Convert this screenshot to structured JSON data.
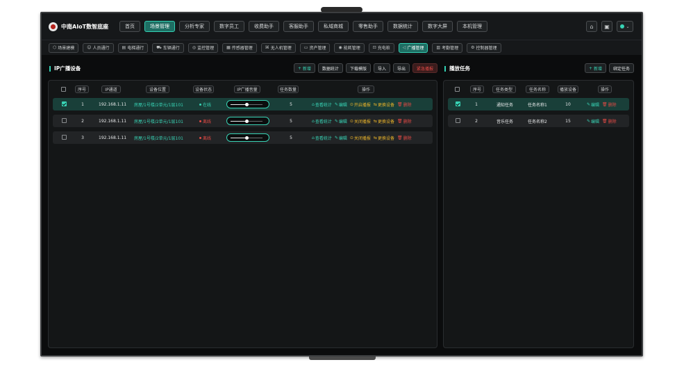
{
  "app": {
    "title": "中南AIoT数智底座"
  },
  "nav": {
    "tabs": [
      "首页",
      "场景管理",
      "分析专家",
      "数字员工",
      "收费助手",
      "客服助手",
      "私域商城",
      "零售助手",
      "数据统计",
      "数字大屏",
      "本机管理"
    ],
    "active": 1
  },
  "subnav": {
    "tabs": [
      "场景建模",
      "人员通行",
      "电梯通行",
      "车辆通行",
      "监控管理",
      "传感器管理",
      "无人机管理",
      "资产管理",
      "能耗管理",
      "充电桩",
      "广播管理",
      "考勤管理",
      "控制器管理"
    ],
    "active": 10
  },
  "left": {
    "title": "IP广播设备",
    "tools": {
      "add": "新增",
      "stats": "数据统计",
      "template": "下载模版",
      "import": "导入",
      "export": "导出",
      "emergency": "紧急播报"
    },
    "headers": [
      "序号",
      "IP通道",
      "设备位置",
      "设备状态",
      "IP广播音量",
      "任务数量",
      "操作"
    ],
    "rows": [
      {
        "no": "1",
        "ip": "192.168.1.11",
        "loc": "房屋/1号楼/2单元/1层101",
        "status": "在线",
        "online": true,
        "volume": 0.5,
        "tasks": "5",
        "checked": true,
        "toggle": "开启播报"
      },
      {
        "no": "2",
        "ip": "192.168.1.11",
        "loc": "房屋/1号楼/2单元/1层101",
        "status": "离线",
        "online": false,
        "volume": 0.5,
        "tasks": "5",
        "checked": false,
        "toggle": "关闭播报"
      },
      {
        "no": "3",
        "ip": "192.168.1.11",
        "loc": "房屋/1号楼/2单元/1层101",
        "status": "离线",
        "online": false,
        "volume": 0.5,
        "tasks": "5",
        "checked": false,
        "toggle": "关闭播报"
      }
    ],
    "actions": {
      "stats": "查看统计",
      "edit": "编辑",
      "replace": "更换设备",
      "del": "删除"
    }
  },
  "right": {
    "title": "播放任务",
    "tools": {
      "add": "新增",
      "bind": "绑定任务"
    },
    "headers": [
      "序号",
      "任务类型",
      "任务名称",
      "播放设备",
      "操作"
    ],
    "rows": [
      {
        "no": "1",
        "type": "通知任务",
        "name": "任务名称1",
        "devices": "10",
        "checked": true
      },
      {
        "no": "2",
        "type": "音乐任务",
        "name": "任务名称2",
        "devices": "15",
        "checked": false
      }
    ],
    "actions": {
      "edit": "编辑",
      "del": "删除"
    }
  },
  "colors": {
    "accent": "#38d3b5",
    "danger": "#e24a45",
    "warning": "#e8b22a"
  }
}
